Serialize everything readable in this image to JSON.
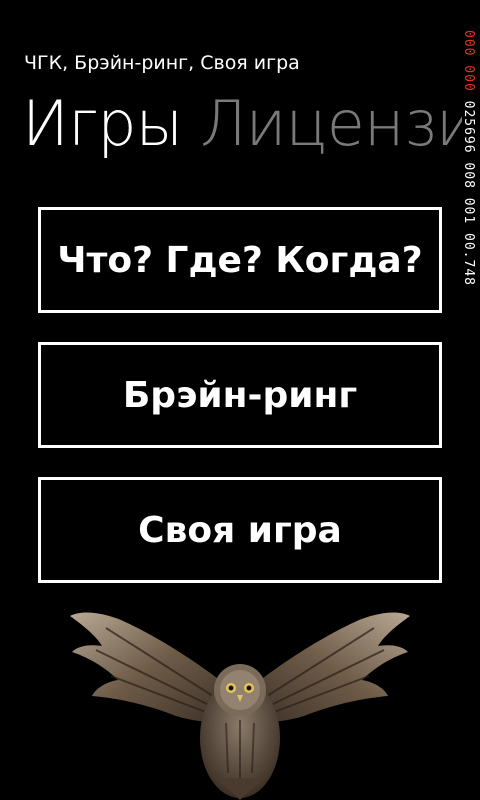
{
  "app": {
    "title": "ЧГК, Брэйн-ринг, Своя игра"
  },
  "pivot": {
    "active": "Игры",
    "next": "Лицензи"
  },
  "debug_counter": {
    "red": "000 000",
    "white": "025696 008 001 00.748"
  },
  "menu": {
    "items": [
      {
        "label": "Что? Где? Когда?"
      },
      {
        "label": "Брэйн-ринг"
      },
      {
        "label": "Своя игра"
      }
    ]
  },
  "image": {
    "icon": "owl-icon"
  }
}
